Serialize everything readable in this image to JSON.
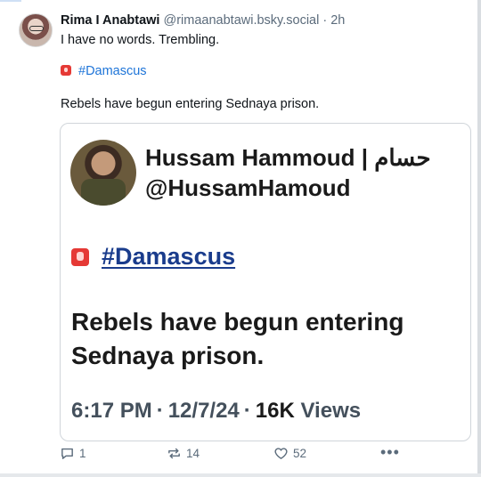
{
  "post": {
    "author_name": "Rima I Anabtawi",
    "author_handle": "@rimaanabtawi.bsky.social",
    "separator": "·",
    "time_ago": "2h",
    "text_line1": "I have no words. Trembling.",
    "hashtag": "#Damascus",
    "text_line3": "Rebels have begun entering Sednaya prison."
  },
  "quote": {
    "author_name": "Hussam Hammoud | حسام",
    "author_handle": "@HussamHamoud",
    "hashtag": "#Damascus",
    "body": "Rebels have begun entering Sednaya prison.",
    "time": "6:17 PM",
    "date": "12/7/24",
    "views_count": "16K",
    "views_label": "Views",
    "dot": "·"
  },
  "actions": {
    "reply_count": "1",
    "repost_count": "14",
    "like_count": "52",
    "more_label": "•••"
  },
  "icons": {
    "siren": "siren-emoji-icon",
    "reply": "reply-icon",
    "repost": "repost-icon",
    "like": "heart-icon",
    "more": "more-dots-icon"
  },
  "colors": {
    "link": "#1d74d8",
    "quote_link": "#1a3c8c",
    "muted": "#5b6b7b",
    "siren": "#e53935"
  }
}
